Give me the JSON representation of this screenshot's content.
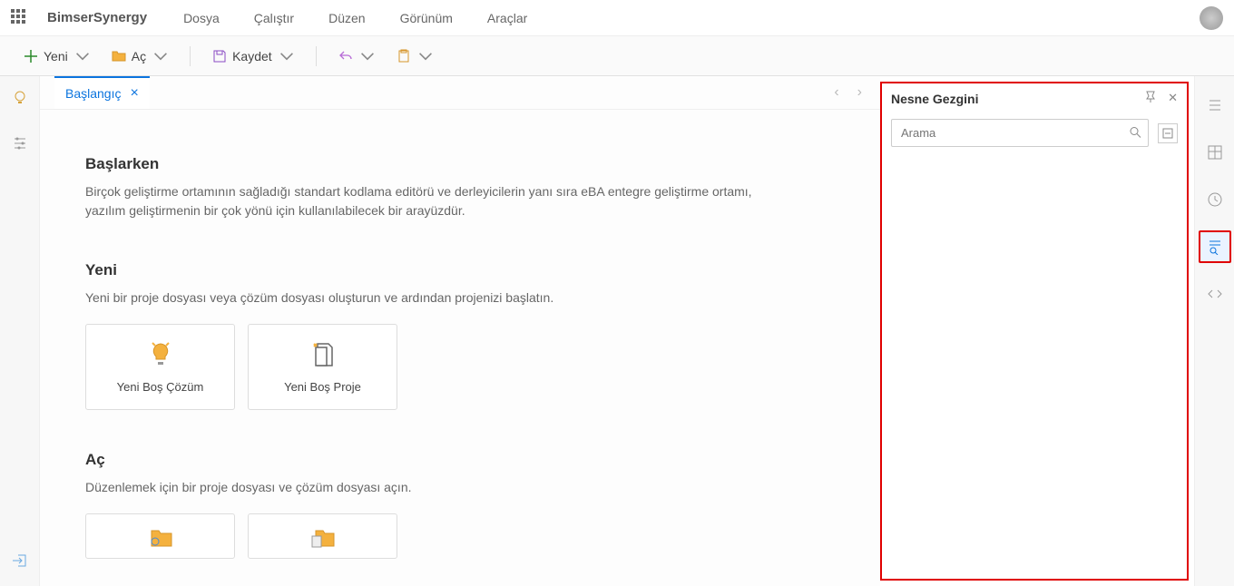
{
  "header": {
    "app_name": "BimserSynergy",
    "menu": [
      "Dosya",
      "Çalıştır",
      "Düzen",
      "Görünüm",
      "Araçlar"
    ]
  },
  "toolbar": {
    "new": "Yeni",
    "open": "Aç",
    "save": "Kaydet"
  },
  "tab": {
    "label": "Başlangıç"
  },
  "start": {
    "getting_started_title": "Başlarken",
    "getting_started_desc": "Birçok geliştirme ortamının sağladığı standart kodlama editörü ve derleyicilerin yanı sıra eBA entegre geliştirme ortamı, yazılım geliştirmenin bir çok yönü için kullanılabilecek bir arayüzdür.",
    "new_title": "Yeni",
    "new_desc": "Yeni bir proje dosyası veya çözüm dosyası oluşturun ve ardından projenizi başlatın.",
    "card_new_solution": "Yeni Boş Çözüm",
    "card_new_project": "Yeni Boş Proje",
    "open_title": "Aç",
    "open_desc": "Düzenlemek için bir proje dosyası ve çözüm dosyası açın."
  },
  "object_explorer": {
    "title": "Nesne Gezgini",
    "search_placeholder": "Arama"
  }
}
